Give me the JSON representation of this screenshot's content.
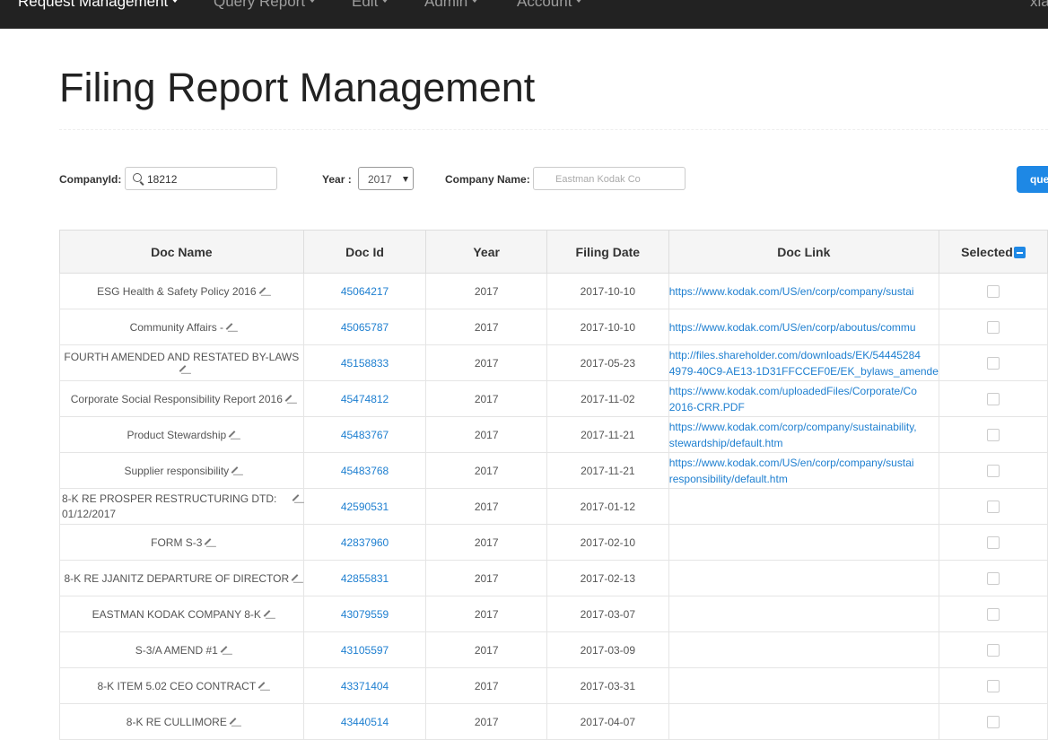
{
  "nav": {
    "items": [
      "Request Management",
      "Query Report",
      "Edit",
      "Admin",
      "Account"
    ],
    "user": "xia"
  },
  "page_title": "Filing Report Management",
  "filters": {
    "company_id_label": "CompanyId:",
    "company_id_value": "18212",
    "year_label": "Year :",
    "year_value": "2017",
    "company_name_label": "Company Name:",
    "company_name_placeholder": "Eastman Kodak Co",
    "query_button": "que"
  },
  "table": {
    "headers": [
      "Doc Name",
      "Doc Id",
      "Year",
      "Filing Date",
      "Doc Link",
      "Selected"
    ],
    "rows": [
      {
        "name": "ESG Health & Safety Policy 2016",
        "id": "45064217",
        "year": "2017",
        "date": "2017-10-10",
        "link1": "https://www.kodak.com/US/en/corp/company/sustai",
        "link2": ""
      },
      {
        "name": "Community Affairs -",
        "id": "45065787",
        "year": "2017",
        "date": "2017-10-10",
        "link1": "https://www.kodak.com/US/en/corp/aboutus/commu",
        "link2": ""
      },
      {
        "name": "FOURTH AMENDED AND RESTATED BY-LAWS",
        "id": "45158833",
        "year": "2017",
        "date": "2017-05-23",
        "link1": "http://files.shareholder.com/downloads/EK/54445284",
        "link2": "4979-40C9-AE13-1D31FFCCEF0E/EK_bylaws_amende"
      },
      {
        "name": "Corporate Social Responsibility Report 2016",
        "id": "45474812",
        "year": "2017",
        "date": "2017-11-02",
        "link1": "https://www.kodak.com/uploadedFiles/Corporate/Co",
        "link2": "2016-CRR.PDF"
      },
      {
        "name": "Product Stewardship",
        "id": "45483767",
        "year": "2017",
        "date": "2017-11-21",
        "link1": "https://www.kodak.com/corp/company/sustainability,",
        "link2": "stewardship/default.htm"
      },
      {
        "name": "Supplier responsibility",
        "id": "45483768",
        "year": "2017",
        "date": "2017-11-21",
        "link1": "https://www.kodak.com/US/en/corp/company/sustai",
        "link2": "responsibility/default.htm"
      },
      {
        "name": "8-K RE PROSPER RESTRUCTURING DTD:",
        "name2": "01/12/2017",
        "id": "42590531",
        "year": "2017",
        "date": "2017-01-12",
        "link1": "",
        "link2": ""
      },
      {
        "name": "FORM S-3",
        "id": "42837960",
        "year": "2017",
        "date": "2017-02-10",
        "link1": "",
        "link2": ""
      },
      {
        "name": "8-K RE JJANITZ DEPARTURE OF DIRECTOR",
        "id": "42855831",
        "year": "2017",
        "date": "2017-02-13",
        "link1": "",
        "link2": ""
      },
      {
        "name": "EASTMAN KODAK COMPANY 8-K",
        "id": "43079559",
        "year": "2017",
        "date": "2017-03-07",
        "link1": "",
        "link2": ""
      },
      {
        "name": "S-3/A AMEND #1",
        "id": "43105597",
        "year": "2017",
        "date": "2017-03-09",
        "link1": "",
        "link2": ""
      },
      {
        "name": "8-K ITEM 5.02 CEO CONTRACT",
        "id": "43371404",
        "year": "2017",
        "date": "2017-03-31",
        "link1": "",
        "link2": ""
      },
      {
        "name": "8-K RE CULLIMORE",
        "id": "43440514",
        "year": "2017",
        "date": "2017-04-07",
        "link1": "",
        "link2": ""
      }
    ]
  }
}
